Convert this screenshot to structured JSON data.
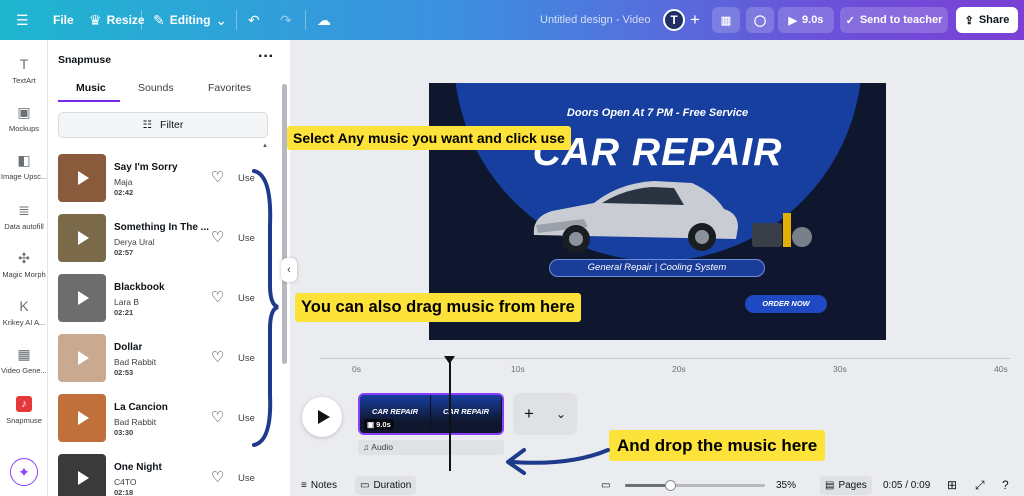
{
  "topbar": {
    "file_label": "File",
    "resize_label": "Resize",
    "editing_label": "Editing",
    "doc_title": "Untitled design - Video",
    "avatar_initial": "T",
    "play_duration": "9.0s",
    "send_label": "Send to teacher",
    "share_label": "Share"
  },
  "rail": {
    "items": [
      {
        "label": "TextArt",
        "icon": "text-art-icon"
      },
      {
        "label": "Mockups",
        "icon": "mockups-icon"
      },
      {
        "label": "Image Upsc...",
        "icon": "image-upscaler-icon"
      },
      {
        "label": "Data autofill",
        "icon": "database-icon"
      },
      {
        "label": "Magic Morph",
        "icon": "magic-morph-icon"
      },
      {
        "label": "Krikey AI A...",
        "icon": "krikey-icon"
      },
      {
        "label": "Video Gene...",
        "icon": "video-generator-icon"
      },
      {
        "label": "Snapmuse",
        "icon": "snapmuse-icon"
      }
    ]
  },
  "panel": {
    "title": "Snapmuse",
    "tabs": [
      "Music",
      "Sounds",
      "Favorites"
    ],
    "filter_label": "Filter",
    "use_label": "Use",
    "tracks": [
      {
        "name": "Say I'm Sorry",
        "artist": "Maja",
        "duration": "02:42",
        "color": "#8a5a3c"
      },
      {
        "name": "Something In The ...",
        "artist": "Derya Ural",
        "duration": "02:57",
        "color": "#7b6a4a"
      },
      {
        "name": "Blackbook",
        "artist": "Lara B",
        "duration": "02:21",
        "color": "#6d6d6d"
      },
      {
        "name": "Dollar",
        "artist": "Bad Rabbit",
        "duration": "02:53",
        "color": "#c9a98f"
      },
      {
        "name": "La Cancion",
        "artist": "Bad Rabbit",
        "duration": "03:30",
        "color": "#c0703a"
      },
      {
        "name": "One Night",
        "artist": "C4TO",
        "duration": "02:18",
        "color": "#3a3a3a"
      }
    ]
  },
  "design": {
    "top_line": "Doors Open At 7 PM - Free Service",
    "title": "CAR REPAIR",
    "subtitle": "General Repair | Cooling System",
    "cta": "ORDER NOW"
  },
  "callouts": {
    "select": "Select Any music you want and click use",
    "drag": "You can also drag music from here",
    "drop": "And drop the music here"
  },
  "timeline": {
    "ticks": [
      "0s",
      "10s",
      "20s",
      "30s",
      "40s"
    ],
    "clip_title": "CAR REPAIR",
    "clip_duration": "9.0s",
    "audio_label": "Audio"
  },
  "footer": {
    "notes_label": "Notes",
    "duration_label": "Duration",
    "zoom": "35%",
    "zoom_fraction": 0.32,
    "pages_label": "Pages",
    "time": "0:05 / 0:09"
  }
}
